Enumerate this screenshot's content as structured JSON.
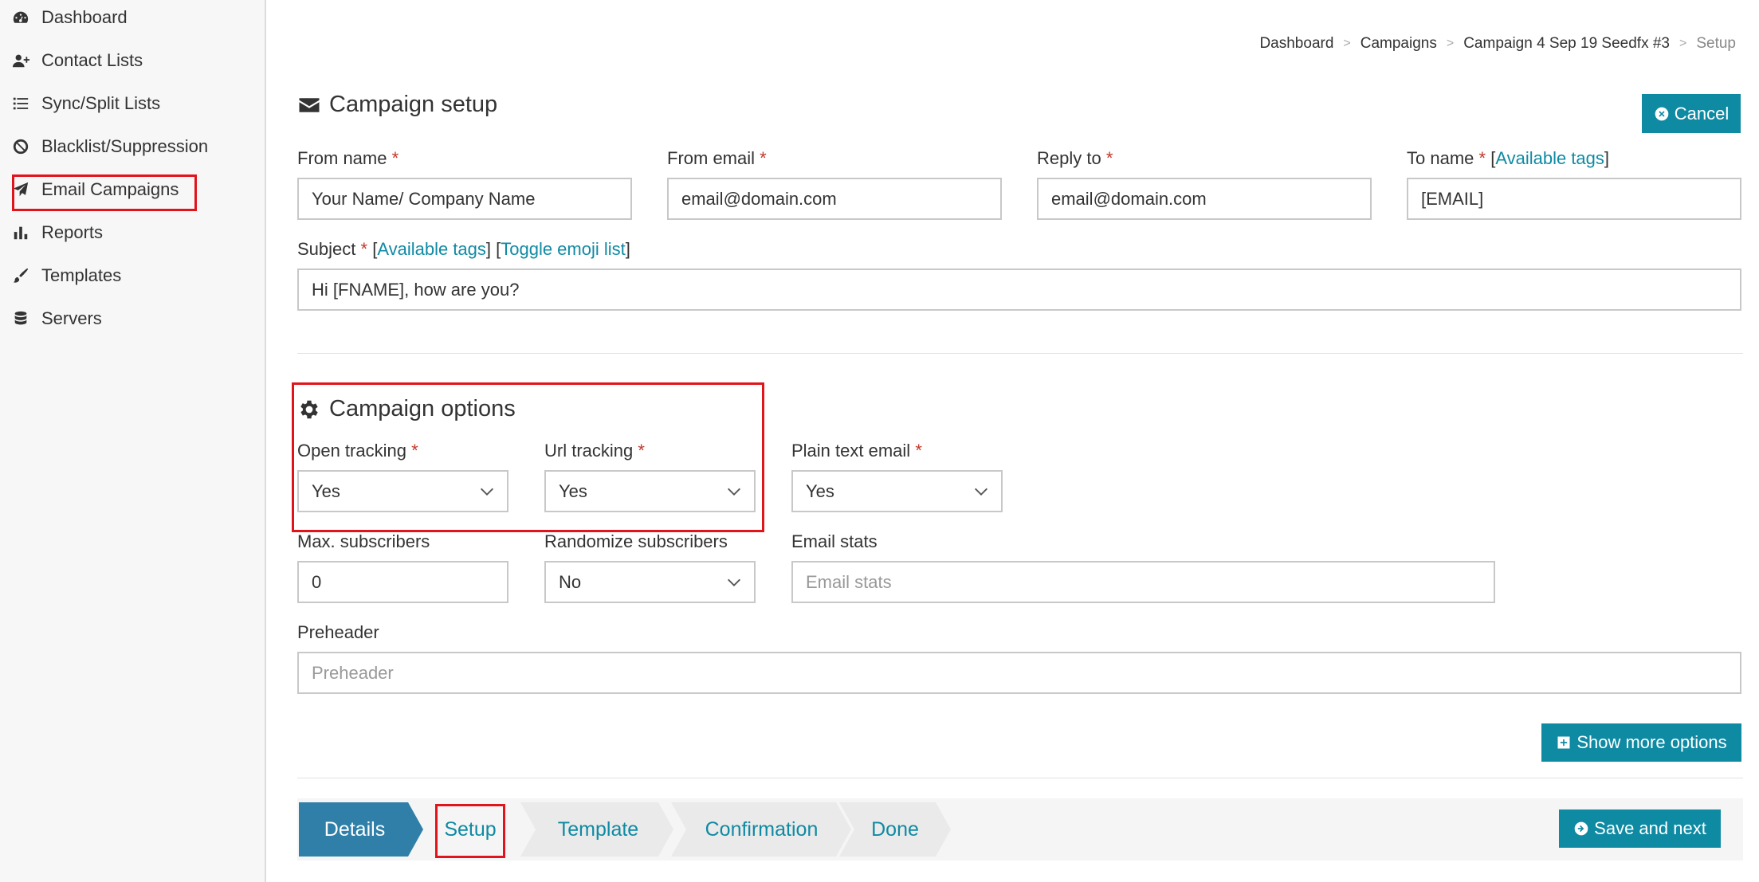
{
  "sidebar": {
    "items": [
      {
        "label": "Dashboard",
        "icon": "dashboard-icon"
      },
      {
        "label": "Contact Lists",
        "icon": "user-plus-icon"
      },
      {
        "label": "Sync/Split Lists",
        "icon": "list-icon"
      },
      {
        "label": "Blacklist/Suppression",
        "icon": "ban-icon"
      },
      {
        "label": "Email Campaigns",
        "icon": "paper-plane-icon"
      },
      {
        "label": "Reports",
        "icon": "bar-chart-icon"
      },
      {
        "label": "Templates",
        "icon": "brush-icon"
      },
      {
        "label": "Servers",
        "icon": "database-icon"
      }
    ]
  },
  "breadcrumb": {
    "items": [
      "Dashboard",
      "Campaigns",
      "Campaign 4 Sep 19 Seedfx #3",
      "Setup"
    ],
    "separator": ">"
  },
  "setup": {
    "title": "Campaign setup",
    "cancel_label": "Cancel",
    "from_name": {
      "label": "From name",
      "required": "*",
      "value": "Your Name/ Company Name"
    },
    "from_email": {
      "label": "From email",
      "required": "*",
      "value": "email@domain.com"
    },
    "reply_to": {
      "label": "Reply to",
      "required": "*",
      "value": "email@domain.com"
    },
    "to_name": {
      "label": "To name",
      "required": "*",
      "link": "Available tags",
      "value": "[EMAIL]"
    },
    "subject": {
      "label": "Subject",
      "required": "*",
      "link1": "Available tags",
      "link2": "Toggle emoji list",
      "value": "Hi [FNAME], how are you?"
    }
  },
  "options": {
    "title": "Campaign options",
    "open_tracking": {
      "label": "Open tracking",
      "required": "*",
      "value": "Yes"
    },
    "url_tracking": {
      "label": "Url tracking",
      "required": "*",
      "value": "Yes"
    },
    "plain_text": {
      "label": "Plain text email",
      "required": "*",
      "value": "Yes"
    },
    "max_subscribers": {
      "label": "Max. subscribers",
      "value": "0"
    },
    "randomize": {
      "label": "Randomize subscribers",
      "value": "No"
    },
    "email_stats": {
      "label": "Email stats",
      "placeholder": "Email stats"
    },
    "preheader": {
      "label": "Preheader",
      "placeholder": "Preheader"
    },
    "show_more_label": "Show more options"
  },
  "wizard": {
    "steps": [
      "Details",
      "Setup",
      "Template",
      "Confirmation",
      "Done"
    ],
    "active": "Details",
    "save_label": "Save and next"
  },
  "colors": {
    "accent": "#0f8aa3",
    "active_step": "#2f7fa8",
    "highlight": "#e1141c",
    "required": "#c0392b"
  }
}
